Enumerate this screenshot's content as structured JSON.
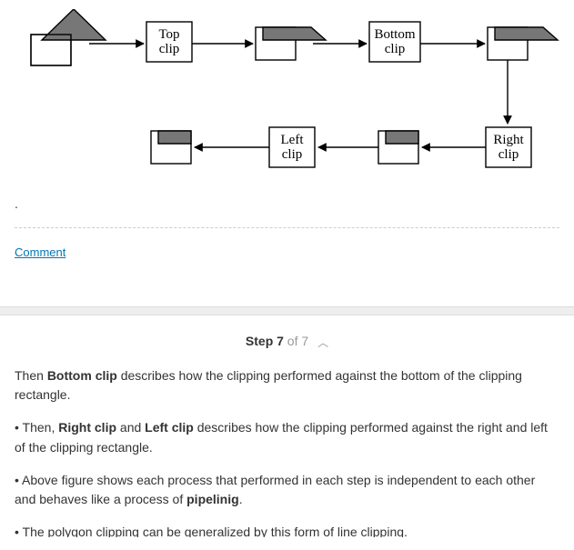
{
  "diagram": {
    "top_clip": "Top\nclip",
    "bottom_clip": "Bottom\nclip",
    "right_clip": "Right\nclip",
    "left_clip": "Left\nclip"
  },
  "dot": ".",
  "comment": "Comment",
  "step": {
    "label_prefix": "Step 7",
    "label_suffix": " of 7"
  },
  "para1_a": "Then ",
  "para1_b": "Bottom clip",
  "para1_c": " describes how the clipping performed against the bottom of the clipping rectangle.",
  "para2_a": "• Then, ",
  "para2_b": "Right clip",
  "para2_c": " and ",
  "para2_d": "Left clip",
  "para2_e": " describes how the clipping performed against the right and left of the clipping rectangle.",
  "para3_a": "• Above figure shows each process that performed in each step is independent to each other and behaves like a process of ",
  "para3_b": "pipelinig",
  "para3_c": ".",
  "para4": "• The polygon clipping can be generalized by this form of line clipping."
}
